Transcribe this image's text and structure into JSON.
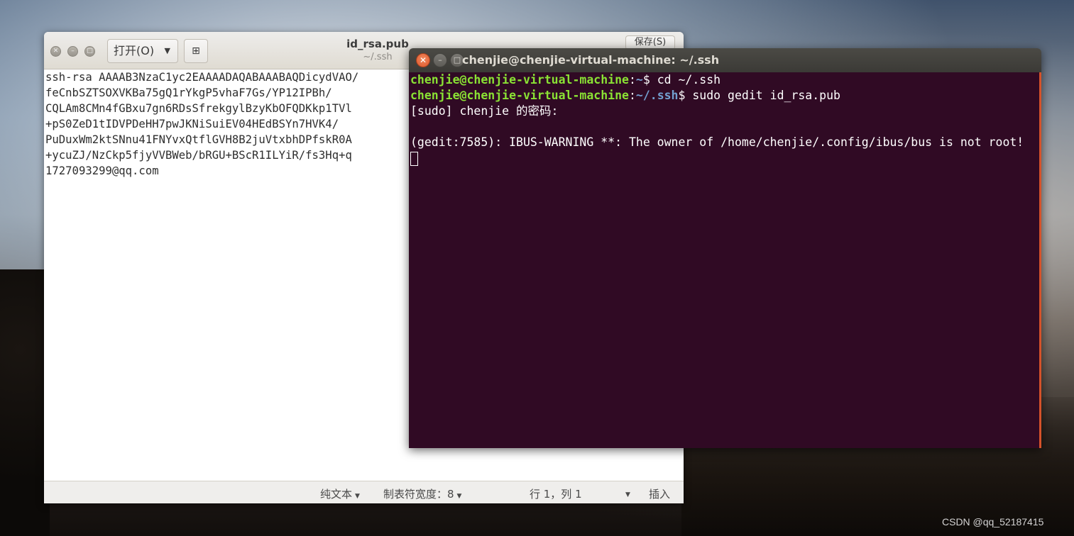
{
  "gedit": {
    "open_label": "打开(O)",
    "save_label": "保存(S)",
    "title": "id_rsa.pub",
    "subtitle": "~/.ssh",
    "lines": [
      "ssh-rsa AAAAB3NzaC1yc2EAAAADAQABAAABAQDicydVAO/",
      "feCnbSZTSOXVKBa75gQ1rYkgP5vhaF7Gs/YP12IPBh/",
      "CQLAm8CMn4fGBxu7gn6RDsSfrekgylBzyKbOFQDKkp1TVl",
      "+pS0ZeD1tIDVPDeHH7pwJKNiSuiEV04HEdBSYn7HVK4/",
      "PuDuxWm2ktSNnu41FNYvxQtflGVH8B2juVtxbhDPfskR0A",
      "+ycuZJ/NzCkp5fjyVVBWeb/bRGU+BScR1ILYiR/fs3Hq+q",
      "1727093299@qq.com"
    ],
    "status": {
      "language": "纯文本",
      "tab_width": "制表符宽度：8",
      "position": "行 1，列 1",
      "mode": "插入"
    }
  },
  "terminal": {
    "title": "chenjie@chenjie-virtual-machine: ~/.ssh",
    "line1": {
      "user": "chenjie@chenjie-virtual-machine",
      "path": "~",
      "cmd": "$ cd ~/.ssh"
    },
    "line2": {
      "user": "chenjie@chenjie-virtual-machine",
      "path": "~/.ssh",
      "cmd": "$ sudo gedit id_rsa.pub"
    },
    "line3": "[sudo] chenjie 的密码:",
    "line4": "",
    "line5": "(gedit:7585): IBUS-WARNING **: The owner of /home/chenjie/.config/ibus/bus is not root!"
  },
  "watermark": "CSDN @qq_52187415"
}
